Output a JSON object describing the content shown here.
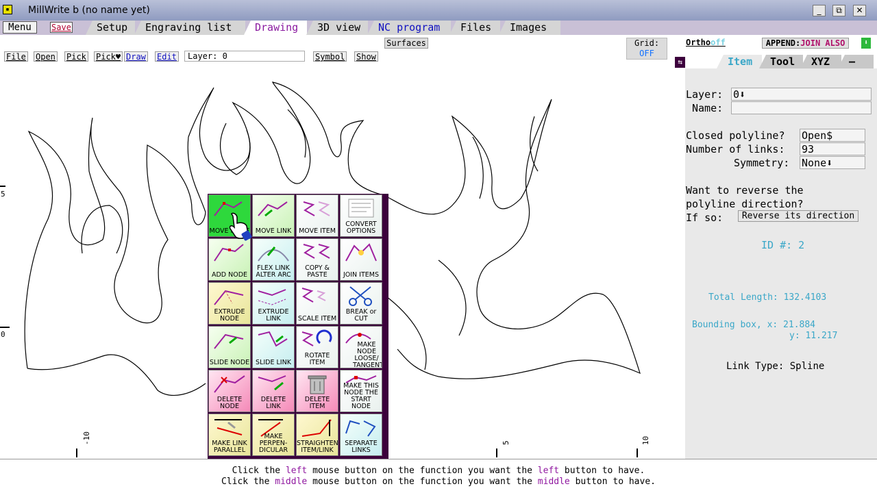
{
  "window": {
    "title": "MillWrite b (no name yet)",
    "min": "_",
    "max": "⧉",
    "close": "✕"
  },
  "tabbar": {
    "menu": "Menu",
    "save": "Save",
    "tabs": [
      "Setup",
      "Engraving list",
      "Drawing",
      "3D view",
      "NC program",
      "Files",
      "Images"
    ],
    "active_tab": "Drawing"
  },
  "toolbar": {
    "file": "File",
    "open": "Open",
    "pick": "Pick",
    "pick_heart": "Pick♥",
    "draw": "Draw",
    "edit": "Edit",
    "layer": "Layer: 0",
    "symbol": "Symbol",
    "show": "Show",
    "surfaces": "Surfaces",
    "grid_label": "Grid:",
    "grid_value": "OFF"
  },
  "axes": {
    "x_ticks": [
      "-10",
      "5",
      "10"
    ],
    "y_ticks": [
      "5",
      "0"
    ]
  },
  "panel": {
    "ortho": "Ortho",
    "ortho_state": "off",
    "append": "APPEND:",
    "append_value": "JOIN ALSO",
    "tabs": [
      "Item",
      "Tool",
      "XYZ",
      "—"
    ],
    "layer_label": "Layer:",
    "layer_value": "0⬇",
    "name_label": "Name:",
    "name_value": "",
    "closed_label": "Closed polyline?",
    "closed_value": "Open$",
    "links_label": "Number of links:",
    "links_value": "93",
    "symmetry_label": "Symmetry:",
    "symmetry_value": "None⬇",
    "reverse_q1": "Want to reverse the",
    "reverse_q2": "polyline direction?",
    "reverse_q3": "If so:",
    "reverse_btn": "Reverse its direction",
    "id": "ID #: 2",
    "total_length": "Total Length: 132.4103",
    "bbox_x": "Bounding box, x: 21.884",
    "bbox_y": "y: 11.217",
    "link_type_label": "Link Type:",
    "link_type_value": "Spline"
  },
  "tools": [
    [
      "MOVE NODE",
      "MOVE LINK",
      "MOVE ITEM",
      "CONVERT OPTIONS"
    ],
    [
      "ADD NODE",
      "FLEX LINK ALTER ARC",
      "COPY & PASTE",
      "JOIN ITEMS"
    ],
    [
      "EXTRUDE NODE",
      "EXTRUDE LINK",
      "SCALE ITEM",
      "BREAK or CUT"
    ],
    [
      "SLIDE NODE",
      "SLIDE LINK",
      "ROTATE ITEM",
      "MAKE NODE LOOSE/ TANGENT"
    ],
    [
      "DELETE NODE",
      "DELETE LINK",
      "DELETE ITEM",
      "MAKE THIS NODE THE START NODE"
    ],
    [
      "MAKE LINK PARALLEL",
      "MAKE PERPEN- DICULAR",
      "STRAIGHTEN ITEM/LINK",
      "SEPARATE LINKS"
    ]
  ],
  "status": {
    "line1": [
      "Click the ",
      "left",
      " mouse button on the function you want the ",
      "left",
      " button to have."
    ],
    "line2": [
      "Click the ",
      "middle",
      " mouse button on the function you want the ",
      "middle",
      " button to have."
    ]
  },
  "colors": {
    "accent": "#8a1aa0",
    "cyan": "#3aa7c8",
    "selected_tool": "#2ed83c"
  }
}
